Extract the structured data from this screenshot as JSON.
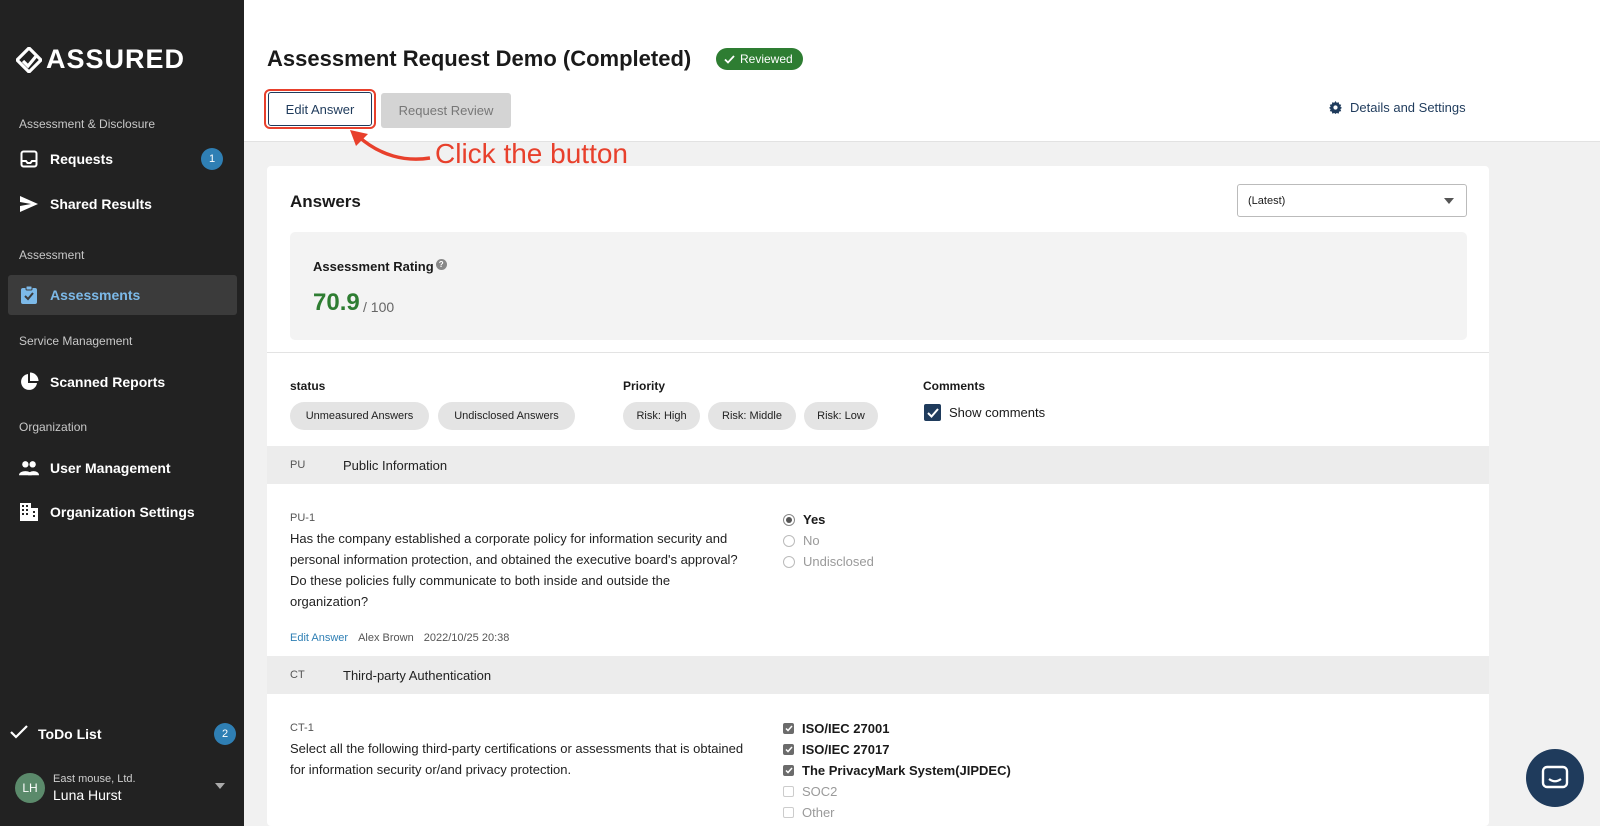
{
  "app": {
    "brand": "ASSURED"
  },
  "sidebar": {
    "sections": [
      {
        "label": "Assessment & Disclosure"
      },
      {
        "label": "Assessment"
      },
      {
        "label": "Service Management"
      },
      {
        "label": "Organization"
      }
    ],
    "items": [
      {
        "label": "Requests",
        "icon": "inbox-icon",
        "badge": "1"
      },
      {
        "label": "Shared Results",
        "icon": "send-icon"
      },
      {
        "label": "Assessments",
        "icon": "clipboard-check-icon",
        "active": true
      },
      {
        "label": "Scanned Reports",
        "icon": "pie-chart-icon"
      },
      {
        "label": "User Management",
        "icon": "users-icon"
      },
      {
        "label": "Organization Settings",
        "icon": "building-icon"
      }
    ],
    "todo": {
      "label": "ToDo List",
      "badge": "2"
    },
    "user": {
      "initials": "LH",
      "org": "East mouse, Ltd.",
      "name": "Luna Hurst"
    }
  },
  "header": {
    "title": "Assessment Request Demo (Completed)",
    "status_badge": "Reviewed",
    "edit_button": "Edit Answer",
    "review_button": "Request Review",
    "settings_link": "Details and Settings"
  },
  "annotation": {
    "text": "Click the button",
    "color": "#e8402c"
  },
  "answers": {
    "title": "Answers",
    "version": "(Latest)",
    "rating_label": "Assessment Rating",
    "rating_value": "70.9",
    "rating_max": "/ 100",
    "filters": {
      "status_label": "status",
      "status_chips": [
        "Unmeasured Answers",
        "Undisclosed Answers"
      ],
      "priority_label": "Priority",
      "priority_chips": [
        "Risk: High",
        "Risk: Middle",
        "Risk: Low"
      ],
      "comments_label": "Comments",
      "show_comments": "Show comments"
    },
    "sections": [
      {
        "code": "PU",
        "name": "Public Information",
        "question": {
          "id": "PU-1",
          "text": "Has the company established a corporate policy for information security and personal information protection, and obtained the executive board's approval? Do these policies fully communicate to both inside and outside the organization?",
          "options": [
            "Yes",
            "No",
            "Undisclosed"
          ],
          "selected": "Yes",
          "edit_link": "Edit Answer",
          "author": "Alex Brown",
          "timestamp": "2022/10/25 20:38"
        }
      },
      {
        "code": "CT",
        "name": "Third-party Authentication",
        "question": {
          "id": "CT-1",
          "text": "Select all the following third-party certifications or assessments that is obtained for information security or/and privacy protection.",
          "options": [
            "ISO/IEC 27001",
            "ISO/IEC 27017",
            "The PrivacyMark System(JIPDEC)",
            "SOC2",
            "Other"
          ],
          "checked": [
            "ISO/IEC 27001",
            "ISO/IEC 27017",
            "The PrivacyMark System(JIPDEC)"
          ]
        }
      }
    ]
  },
  "colors": {
    "sidebar": "#222222",
    "accent_blue": "#2f7fb4",
    "success": "#2e7d32",
    "navy": "#1f3b5c"
  }
}
